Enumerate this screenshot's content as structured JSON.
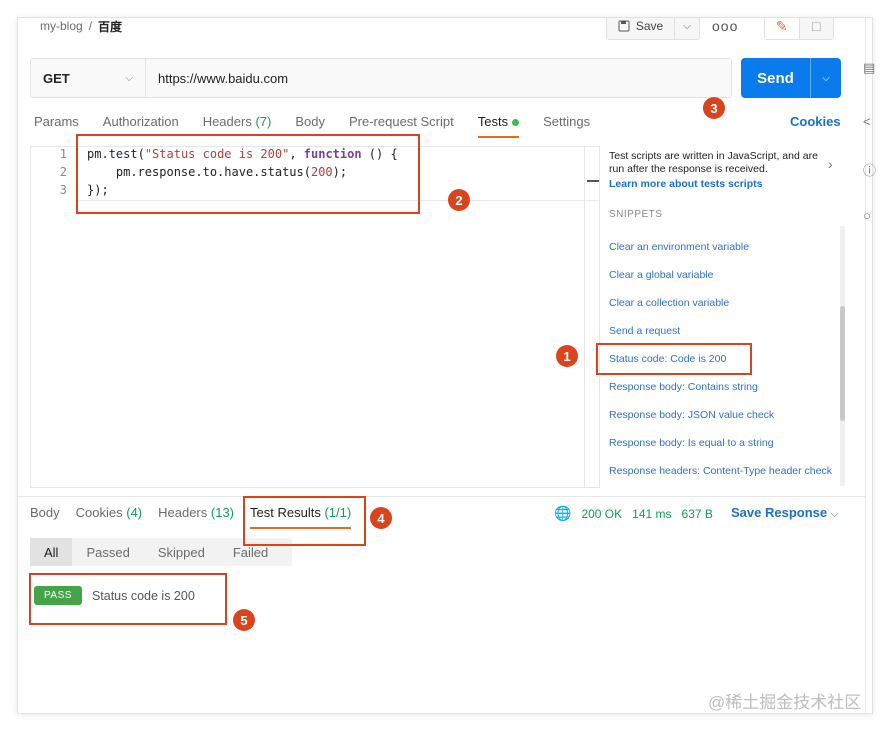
{
  "breadcrumb": {
    "collection": "my-blog",
    "separator": "/",
    "request": "百度"
  },
  "toolbar": {
    "save_label": "Save",
    "more_label": "ooo"
  },
  "request": {
    "method": "GET",
    "url": "https://www.baidu.com",
    "send_label": "Send"
  },
  "tabs": [
    {
      "label": "Params",
      "count": ""
    },
    {
      "label": "Authorization",
      "count": ""
    },
    {
      "label": "Headers",
      "count": "(7)"
    },
    {
      "label": "Body",
      "count": ""
    },
    {
      "label": "Pre-request Script",
      "count": ""
    },
    {
      "label": "Tests",
      "count": ""
    },
    {
      "label": "Settings",
      "count": ""
    }
  ],
  "cookies_label": "Cookies",
  "editor": {
    "line_numbers": [
      "1",
      "2",
      "3"
    ]
  },
  "snippets": {
    "description": "Test scripts are written in JavaScript, and are run after the response is received.",
    "learn_more": "Learn more about tests scripts",
    "title": "SNIPPETS",
    "items": [
      "Clear an environment variable",
      "Clear a global variable",
      "Clear a collection variable",
      "Send a request",
      "Status code: Code is 200",
      "Response body: Contains string",
      "Response body: JSON value check",
      "Response body: Is equal to a string",
      "Response headers: Content-Type header check"
    ]
  },
  "response": {
    "tabs": [
      {
        "label": "Body",
        "count": ""
      },
      {
        "label": "Cookies",
        "count": "(4)"
      },
      {
        "label": "Headers",
        "count": "(13)"
      },
      {
        "label": "Test Results",
        "count": "(1/1)"
      }
    ],
    "status": "200 OK",
    "time": "141 ms",
    "size": "637 B",
    "save_label": "Save Response",
    "filters": [
      "All",
      "Passed",
      "Skipped",
      "Failed"
    ],
    "result": {
      "badge": "PASS",
      "text": "Status code is 200"
    }
  },
  "annotations": [
    "1",
    "2",
    "3",
    "4",
    "5"
  ],
  "watermark": "@稀土掘金技术社区"
}
